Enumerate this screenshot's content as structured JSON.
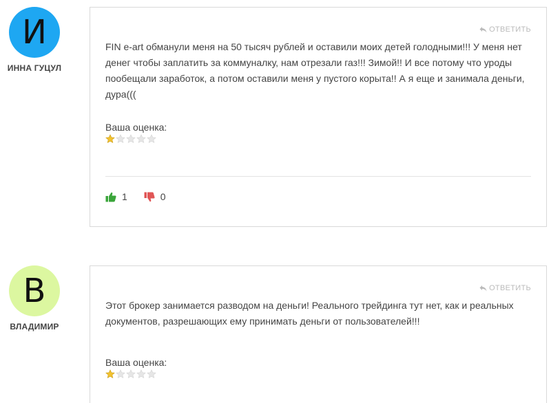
{
  "comments": [
    {
      "avatar_letter": "И",
      "avatar_color": "#1ea7f2",
      "author": "ИННА ГУЦУЛ",
      "reply_label": "ОТВЕТИТЬ",
      "text": "FIN e-art обманули меня на 50 тысяч рублей и оставили моих детей голодными!!! У меня нет денег чтобы заплатить за коммуналку, нам отрезали газ!!! Зимой!! И все потому что уроды пообещали заработок, а потом оставили меня у пустого корыта!! А я еще и занимала деньги, дура(((",
      "rating_label": "Ваша оценка:",
      "rating": 1,
      "rating_max": 5,
      "likes": "1",
      "dislikes": "0"
    },
    {
      "avatar_letter": "В",
      "avatar_color": "#dcf7a0",
      "author": "ВЛАДИМИР",
      "reply_label": "ОТВЕТИТЬ",
      "text": "Этот брокер занимается разводом на деньги! Реального трейдинга тут нет, как и реальных документов, разрешающих ему принимать деньги от пользователей!!!",
      "rating_label": "Ваша оценка:",
      "rating": 1,
      "rating_max": 5
    }
  ],
  "colors": {
    "star_filled": "#f2c230",
    "star_empty": "#e6e6e6",
    "like": "#3aa53a",
    "dislike": "#e05656"
  }
}
